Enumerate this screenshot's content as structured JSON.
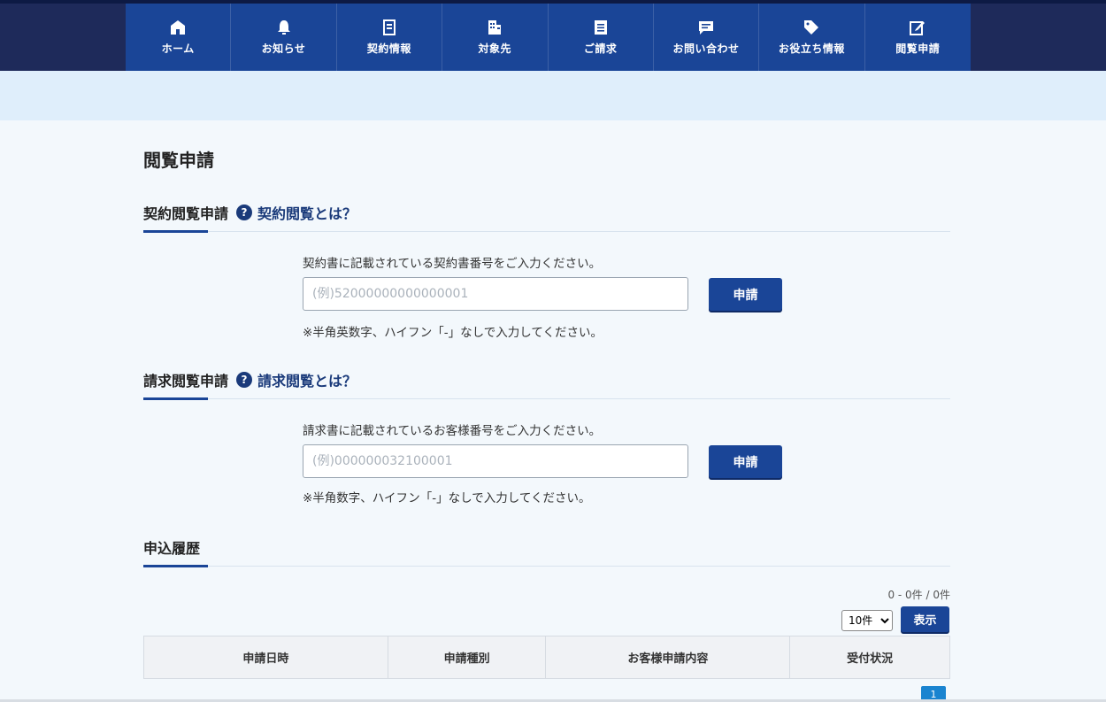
{
  "nav": {
    "items": [
      {
        "label": "ホーム",
        "icon": "home-icon"
      },
      {
        "label": "お知らせ",
        "icon": "bell-icon"
      },
      {
        "label": "契約情報",
        "icon": "document-icon"
      },
      {
        "label": "対象先",
        "icon": "building-icon"
      },
      {
        "label": "ご請求",
        "icon": "invoice-icon"
      },
      {
        "label": "お問い合わせ",
        "icon": "chat-icon"
      },
      {
        "label": "お役立ち情報",
        "icon": "tag-icon"
      },
      {
        "label": "閲覧申請",
        "icon": "edit-icon"
      }
    ]
  },
  "page": {
    "title": "閲覧申請"
  },
  "contract": {
    "heading": "契約閲覧申請",
    "help_link": "契約閲覧とは？",
    "instruction": "契約書に記載されている契約書番号をご入力ください。",
    "placeholder": "(例)52000000000000001",
    "button": "申請",
    "note": "※半角英数字、ハイフン「-」なしで入力してください。"
  },
  "invoice": {
    "heading": "請求閲覧申請",
    "help_link": "請求閲覧とは？",
    "instruction": "請求書に記載されているお客様番号をご入力ください。",
    "placeholder": "(例)000000032100001",
    "button": "申請",
    "note": "※半角数字、ハイフン「-」なしで入力してください。"
  },
  "history": {
    "heading": "申込履歴",
    "count": "0 - 0件 / 0件",
    "per_page": "10件",
    "show_button": "表示",
    "columns": [
      "申請日時",
      "申請種別",
      "お客様申請内容",
      "受付状況"
    ],
    "current_page": "1"
  },
  "colors": {
    "nav": "#1a4597",
    "header_bg": "#1e2a5a",
    "accent": "#1a4597",
    "pager": "#1a84d0"
  }
}
